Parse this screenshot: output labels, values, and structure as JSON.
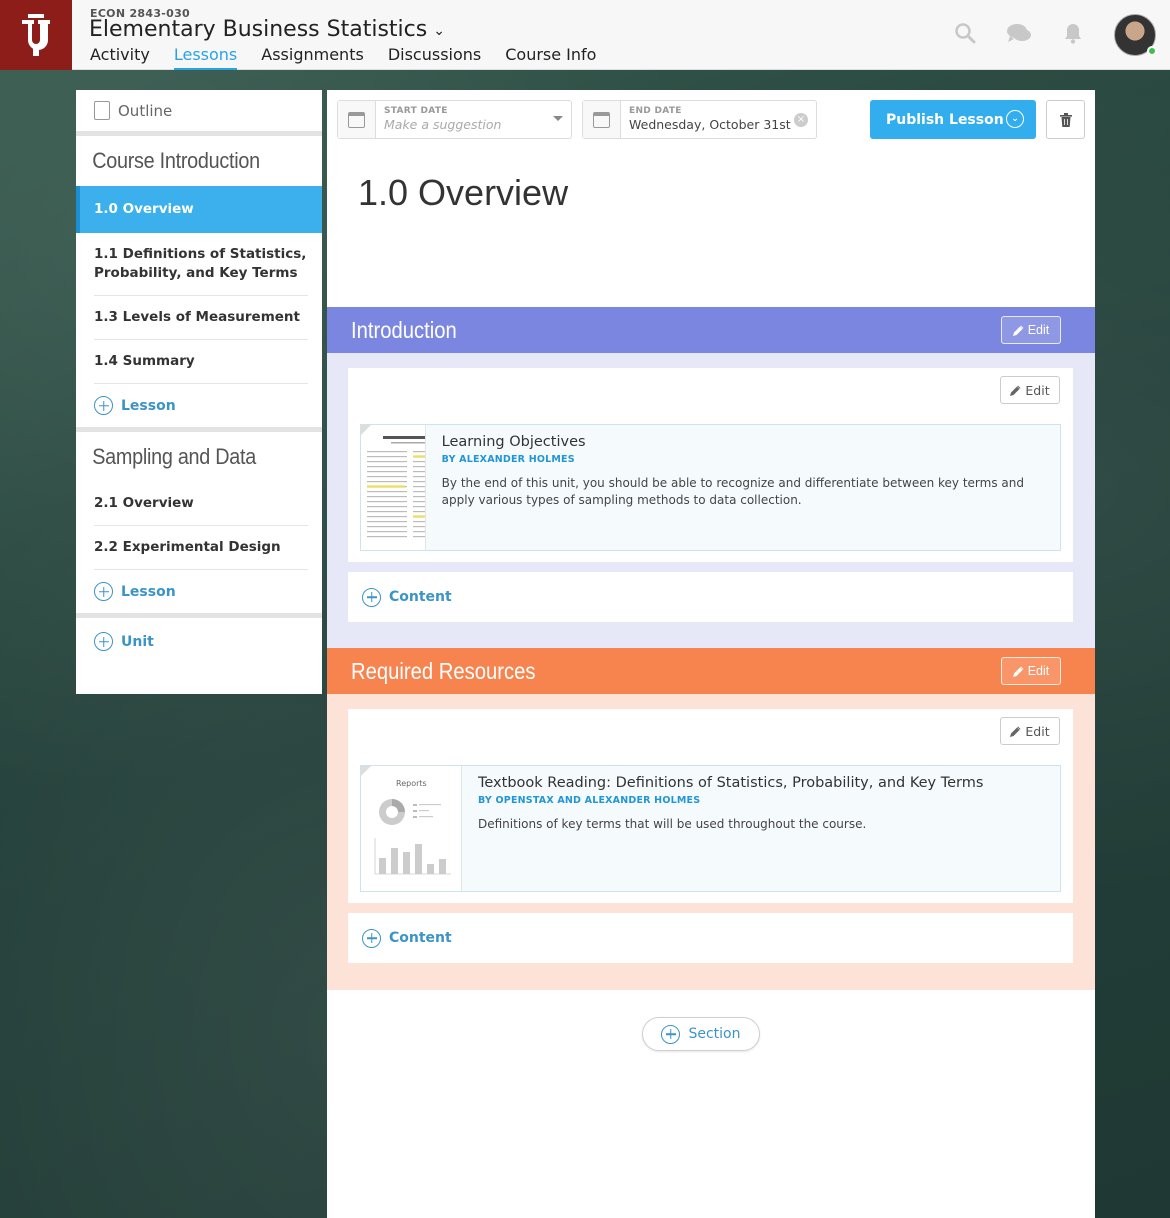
{
  "header": {
    "course_code": "ECON 2843-030",
    "course_title": "Elementary Business Statistics",
    "nav": [
      {
        "label": "Activity",
        "active": false
      },
      {
        "label": "Lessons",
        "active": true
      },
      {
        "label": "Assignments",
        "active": false
      },
      {
        "label": "Discussions",
        "active": false
      },
      {
        "label": "Course Info",
        "active": false
      }
    ],
    "icons": [
      "search-icon",
      "chat-icon",
      "bell-icon"
    ],
    "accent_color": "#29a3e6",
    "brand_color": "#8c1d19"
  },
  "sidebar": {
    "outline_label": "Outline",
    "units": [
      {
        "title": "Course Introduction",
        "lessons": [
          {
            "label": "1.0 Overview",
            "active": true
          },
          {
            "label": "1.1 Definitions of Statistics, Probability, and Key Terms"
          },
          {
            "label": "1.3 Levels of Measurement"
          },
          {
            "label": "1.4 Summary"
          }
        ],
        "add_label": "Lesson"
      },
      {
        "title": "Sampling and Data",
        "lessons": [
          {
            "label": "2.1 Overview"
          },
          {
            "label": "2.2 Experimental Design"
          }
        ],
        "add_label": "Lesson"
      }
    ],
    "add_unit_label": "Unit"
  },
  "toolbar": {
    "start_date_label": "START DATE",
    "start_date_placeholder": "Make a suggestion",
    "end_date_label": "END DATE",
    "end_date_value": "Wednesday, October 31st",
    "publish_label": "Publish Lesson"
  },
  "lesson": {
    "title": "1.0 Overview",
    "sections": [
      {
        "title": "Introduction",
        "color": "#7b86e0",
        "bg": "#e6e8f8",
        "edit_label": "Edit",
        "card_edit_label": "Edit",
        "item": {
          "title": "Learning Objectives",
          "by": "BY ALEXANDER HOLMES",
          "desc": "By the end of this unit, you should be able to recognize and differentiate between key terms and apply various types of sampling methods to data collection."
        },
        "add_content_label": "Content"
      },
      {
        "title": "Required Resources",
        "color": "#f7844f",
        "bg": "#fde2d8",
        "edit_label": "Edit",
        "card_edit_label": "Edit",
        "item": {
          "title": "Textbook Reading: Definitions of Statistics, Probability, and Key Terms",
          "by": "BY OPENSTAX AND ALEXANDER HOLMES",
          "desc": "Definitions of key terms that will be used throughout the course.",
          "thumb_title": "Reports"
        },
        "add_content_label": "Content"
      }
    ],
    "add_section_label": "Section"
  }
}
